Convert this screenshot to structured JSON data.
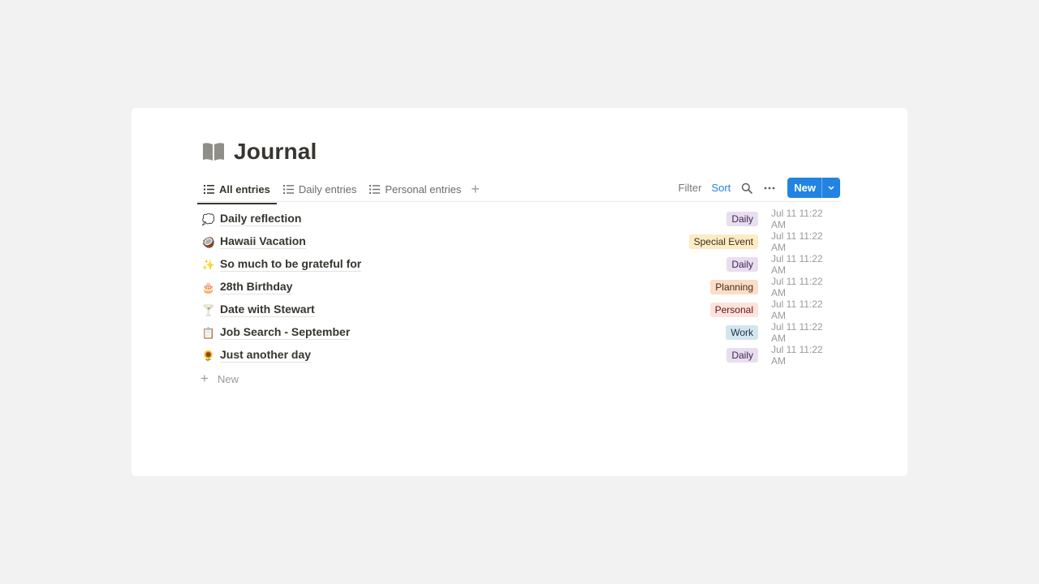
{
  "page": {
    "title": "Journal",
    "icon": "open-book-icon"
  },
  "tabs": [
    {
      "label": "All entries",
      "icon": "list-icon",
      "active": true
    },
    {
      "label": "Daily entries",
      "icon": "list-icon",
      "active": false
    },
    {
      "label": "Personal entries",
      "icon": "list-icon",
      "active": false
    }
  ],
  "add_view_icon": "plus-icon",
  "toolbar": {
    "filter_label": "Filter",
    "sort_label": "Sort",
    "search_icon": "search-icon",
    "more_icon": "more-icon",
    "new_label": "New",
    "new_caret_icon": "chevron-down-icon"
  },
  "entries": [
    {
      "emoji": "💭",
      "title": "Daily reflection",
      "tag": "Daily",
      "date": "Jul 11 11:22 AM"
    },
    {
      "emoji": "🥥",
      "title": "Hawaii Vacation",
      "tag": "Special Event",
      "date": "Jul 11 11:22 AM"
    },
    {
      "emoji": "✨",
      "title": "So much to be grateful for",
      "tag": "Daily",
      "date": "Jul 11 11:22 AM"
    },
    {
      "emoji": "🎂",
      "title": "28th Birthday",
      "tag": "Planning",
      "date": "Jul 11 11:22 AM"
    },
    {
      "emoji": "🍸",
      "title": "Date with Stewart",
      "tag": "Personal",
      "date": "Jul 11 11:22 AM"
    },
    {
      "emoji": "📋",
      "title": "Job Search - September",
      "tag": "Work",
      "date": "Jul 11 11:22 AM"
    },
    {
      "emoji": "🌻",
      "title": "Just another day",
      "tag": "Daily",
      "date": "Jul 11 11:22 AM"
    }
  ],
  "tag_colors": {
    "Daily": {
      "bg": "#e8deee",
      "fg": "#412454"
    },
    "Special Event": {
      "bg": "#fbecc4",
      "fg": "#402c1b"
    },
    "Planning": {
      "bg": "#fadec9",
      "fg": "#49290e"
    },
    "Personal": {
      "bg": "#ffe2dd",
      "fg": "#5d1715"
    },
    "Work": {
      "bg": "#d3e5ef",
      "fg": "#183347"
    }
  },
  "add_row_label": "New",
  "colors": {
    "accent": "#2383e2",
    "text": "#37352f",
    "muted": "#9b9a97",
    "background": "#f2f2f2",
    "card": "#ffffff"
  }
}
